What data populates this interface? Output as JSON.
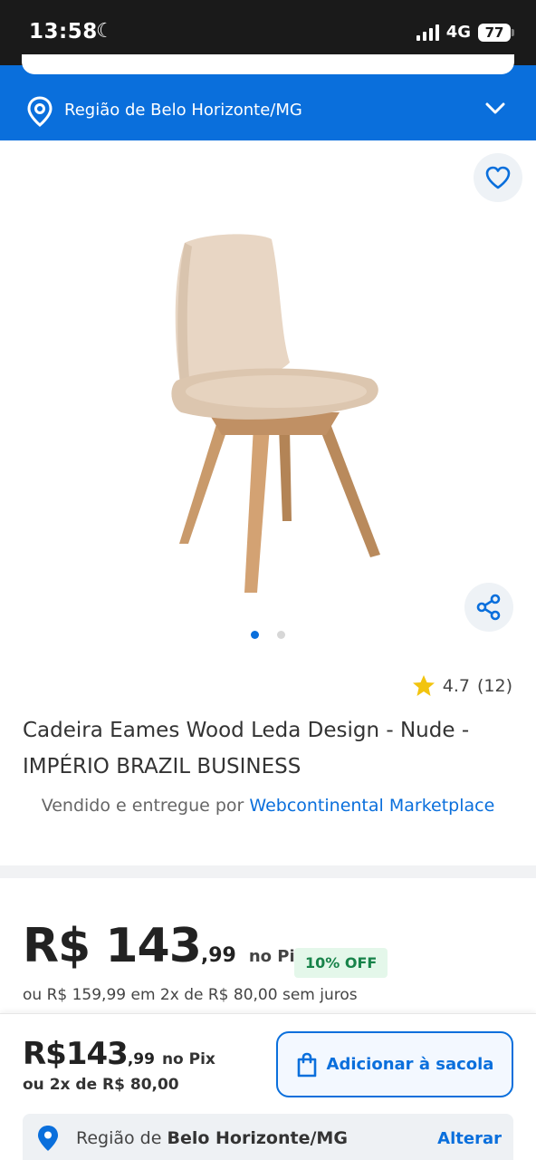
{
  "status_bar": {
    "time": "13:58",
    "network": "4G",
    "battery": "77",
    "icons": [
      "moon-icon",
      "signal-icon",
      "battery-icon"
    ]
  },
  "header": {
    "region_label": "Região de Belo Horizonte/MG",
    "icons": [
      "location-pin-icon",
      "chevron-down-icon"
    ]
  },
  "product": {
    "image_icon_favorite": "heart-icon",
    "image_icon_share": "share-icon",
    "carousel": {
      "count": 2,
      "active_index": 0
    },
    "rating_value": "4.7",
    "rating_count": "(12)",
    "title": "Cadeira Eames Wood Leda Design - Nude - IMPÉRIO BRAZIL BUSINESS",
    "seller_prefix": "Vendido e entregue por ",
    "seller_name": "Webcontinental Marketplace"
  },
  "pricing": {
    "price_int": "R$ 143",
    "price_cents": ",99",
    "pix_label": "no Pix",
    "discount_badge": "10% OFF",
    "installments_text": "ou R$ 159,99 em 2x de R$ 80,00 sem juros"
  },
  "bottom_bar": {
    "price_int": "R$143",
    "price_cents": ",99",
    "pix_label": "no Pix",
    "installments_text": "ou 2x de R$ 80,00",
    "add_button_label": "Adicionar à sacola",
    "region_prefix": "Região de ",
    "region_city": "Belo Horizonte/MG",
    "change_label": "Alterar"
  },
  "colors": {
    "primary": "#0a6fdc",
    "status_bar": "#1a1a1a",
    "discount_bg": "#e4f7ea",
    "discount_text": "#18834a",
    "star": "#f2c40f"
  }
}
